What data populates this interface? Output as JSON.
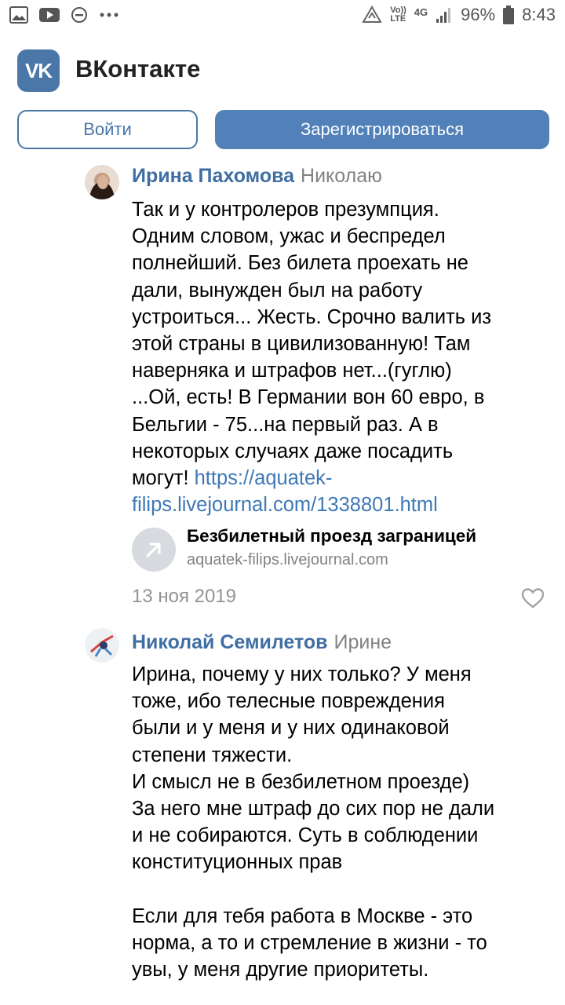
{
  "status_bar": {
    "volte_label": "Vo))",
    "lte_label": "LTE",
    "network": "4G",
    "battery": "96%",
    "time": "8:43"
  },
  "app": {
    "title": "ВКонтакте",
    "logo_text": "VK",
    "brand_color": "#4a76a8"
  },
  "auth": {
    "login_label": "Войти",
    "register_label": "Зарегистрироваться"
  },
  "comments": [
    {
      "author": "Ирина Пахомова",
      "reply_to": "Николаю",
      "text": "Так и у контролеров презумпция.\nОдним словом, ужас и беспредел\nполнейший. Без билета проехать не\nдали, вынужден был на работу\nустроиться... Жесть. Срочно валить из\nэтой страны в цивилизованную! Там\nнаверняка и штрафов нет...(гуглю)\n...Ой, есть! В Германии вон 60 евро, в\nБельгии - 75...на первый раз. А в\nнекоторых случаях даже посадить\nмогут! ",
      "link": "https://aquatek-\nfilips.livejournal.com/1338801.html",
      "snippet": {
        "title": "Безбилетный проезд заграницей",
        "url": "aquatek-filips.livejournal.com"
      },
      "date": "13 ноя 2019"
    },
    {
      "author": "Николай Семилетов",
      "reply_to": "Ирине",
      "text": "Ирина, почему у них только? У меня\nтоже, ибо телесные повреждения\nбыли и у меня и у них одинаковой\nстепени тяжести.\nИ смысл не в безбилетном проезде)\nЗа него мне штраф до сих пор не дали\nи не собираются. Суть в соблюдении\nконституционных прав\n\nЕсли для тебя работа в Москве - это\nнорма, а то и стремление в жизни - то\nувы, у меня другие приоритеты."
    }
  ]
}
